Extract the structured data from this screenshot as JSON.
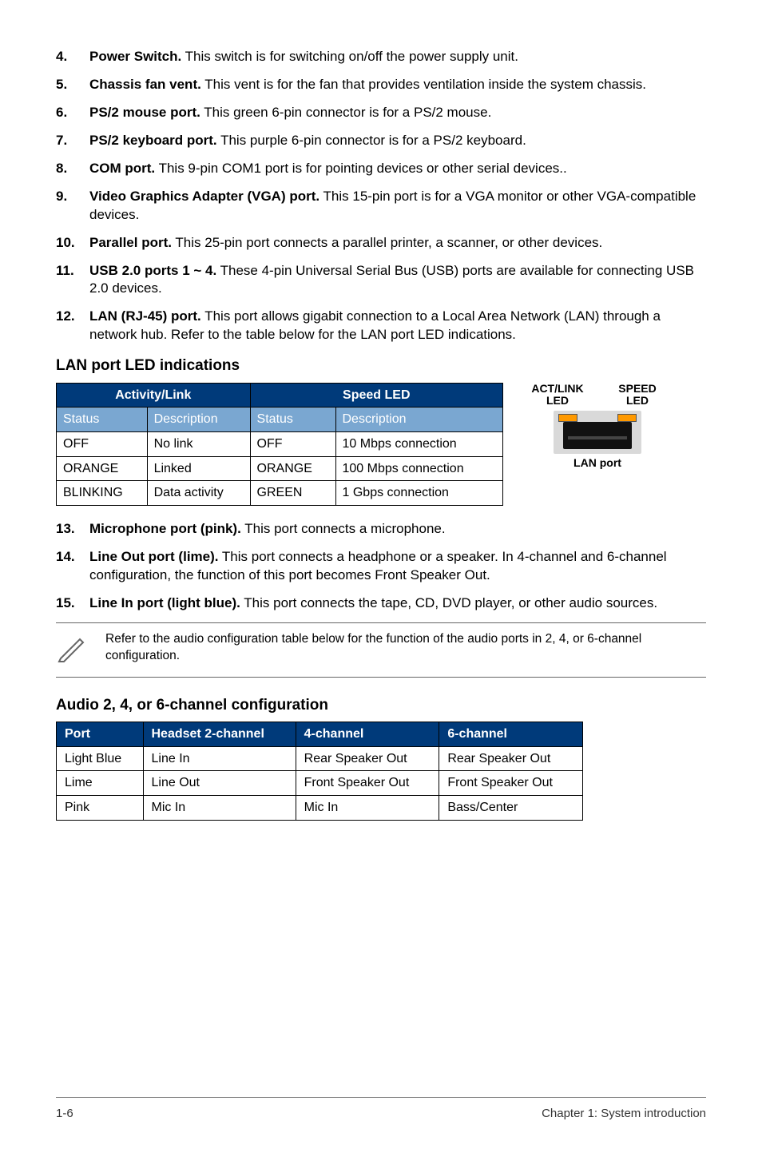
{
  "items": [
    {
      "num": "4.",
      "title": "Power Switch.",
      "text": " This switch is for switching on/off the power supply unit."
    },
    {
      "num": "5.",
      "title": "Chassis fan vent.",
      "text": " This vent is for the fan that provides ventilation inside the system chassis."
    },
    {
      "num": "6.",
      "title": "PS/2 mouse port.",
      "text": " This green 6-pin connector is for a PS/2 mouse."
    },
    {
      "num": "7.",
      "title": "PS/2 keyboard port.",
      "text": " This purple 6-pin connector is for a PS/2 keyboard."
    },
    {
      "num": "8.",
      "title": "COM port.",
      "text": " This 9-pin COM1 port is for pointing devices or other serial devices.."
    },
    {
      "num": "9.",
      "title": "Video Graphics Adapter (VGA) port.",
      "text": " This 15-pin port is for a VGA monitor or other VGA-compatible devices."
    },
    {
      "num": "10.",
      "title": "Parallel port.",
      "text": " This 25-pin port connects a parallel printer, a scanner, or other devices."
    },
    {
      "num": "11.",
      "title": "USB 2.0 ports 1 ~ 4.",
      "text": " These 4-pin Universal Serial Bus (USB) ports are available for connecting USB 2.0 devices."
    },
    {
      "num": "12.",
      "title": "LAN (RJ-45) port.",
      "text": " This port allows gigabit connection to a Local Area Network (LAN) through a network hub. Refer to the table below for the LAN port LED indications."
    }
  ],
  "lan_section_title": "LAN port LED indications",
  "lan_table": {
    "group_headers": [
      "Activity/Link",
      "Speed LED"
    ],
    "sub_headers": [
      "Status",
      "Description",
      "Status",
      "Description"
    ],
    "rows": [
      [
        "OFF",
        "No link",
        "OFF",
        "10 Mbps connection"
      ],
      [
        "ORANGE",
        "Linked",
        "ORANGE",
        "100 Mbps connection"
      ],
      [
        "BLINKING",
        "Data activity",
        "GREEN",
        "1 Gbps connection"
      ]
    ]
  },
  "led_diagram": {
    "left_top": "ACT/LINK",
    "left_bottom": "LED",
    "right_top": "SPEED",
    "right_bottom": "LED",
    "caption": "LAN port"
  },
  "items2": [
    {
      "num": "13.",
      "title": "Microphone port (pink).",
      "text": " This port connects a microphone."
    },
    {
      "num": "14.",
      "title": "Line Out port (lime).",
      "text": " This port connects a headphone or a speaker. In 4-channel and 6-channel configuration, the function of this port becomes Front Speaker Out."
    },
    {
      "num": "15.",
      "title": "Line In port (light blue).",
      "text": " This port connects the tape, CD, DVD player, or other audio sources."
    }
  ],
  "note_text": "Refer to the audio configuration table below for the function of the audio ports in 2, 4, or 6-channel configuration.",
  "audio_section_title": "Audio 2, 4, or 6-channel configuration",
  "audio_table": {
    "headers": [
      "Port",
      "Headset 2-channel",
      "4-channel",
      "6-channel"
    ],
    "rows": [
      [
        "Light Blue",
        "Line In",
        "Rear Speaker Out",
        "Rear Speaker Out"
      ],
      [
        "Lime",
        "Line Out",
        "Front Speaker Out",
        "Front Speaker Out"
      ],
      [
        "Pink",
        "Mic In",
        "Mic In",
        "Bass/Center"
      ]
    ]
  },
  "footer": {
    "left": "1-6",
    "right": "Chapter 1: System introduction"
  }
}
